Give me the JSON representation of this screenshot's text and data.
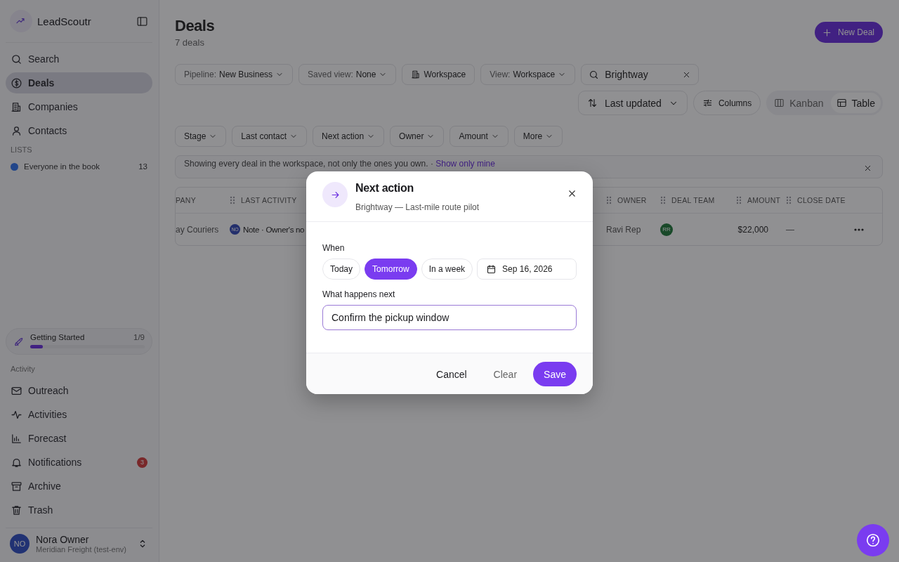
{
  "sidebar": {
    "brand": "LeadScoutr",
    "nav": [
      {
        "label": "Search",
        "selected": false
      },
      {
        "label": "Deals",
        "selected": true
      },
      {
        "label": "Companies",
        "selected": false
      },
      {
        "label": "Contacts",
        "selected": false
      }
    ],
    "lists_heading": "LISTS",
    "lists": [
      {
        "label": "Everyone in the book",
        "count": "13",
        "color": "#22468a"
      }
    ],
    "getting_started": {
      "label": "Getting Started",
      "progress_text": "1/9",
      "level": 0.11
    },
    "activity_heading": "Activity",
    "activity_nav": [
      {
        "label": "Outreach",
        "selected": false
      },
      {
        "label": "Activities",
        "selected": false
      },
      {
        "label": "Forecast",
        "selected": false
      },
      {
        "label": "Notifications",
        "selected": false,
        "badge": "3"
      },
      {
        "label": "Archive",
        "selected": false
      },
      {
        "label": "Trash",
        "selected": false
      }
    ],
    "user": {
      "initials": "NO",
      "name": "Nora Owner",
      "org": "Meridian Freight (test-env)"
    }
  },
  "header": {
    "title": "Deals",
    "subtitle": "7 deals",
    "new_button": "New Deal"
  },
  "toolbar": [
    {
      "kind": "select",
      "label": "Pipeline:",
      "value": "New Business"
    },
    {
      "kind": "select",
      "label": "Saved view:",
      "value": "None"
    },
    {
      "kind": "button",
      "value": "Workspace"
    },
    {
      "kind": "select",
      "label": "View:",
      "value": "Workspace"
    }
  ],
  "search": {
    "value": "Brightway"
  },
  "sort": {
    "label": "Last updated"
  },
  "columns_button": "Columns",
  "view_toggle": [
    {
      "label": "Kanban",
      "selected": false
    },
    {
      "label": "Table",
      "selected": true
    }
  ],
  "filters": [
    "Stage",
    "Last contact",
    "Next action",
    "Owner",
    "Amount",
    "More"
  ],
  "notice": {
    "text": "Showing every deal in the workspace, not only the ones you own.",
    "separator": "·",
    "link": "Show only mine"
  },
  "table": {
    "columns": [
      "PANY",
      "LAST ACTIVITY",
      "OWNER",
      "DEAL TEAM",
      "AMOUNT",
      "CLOSE DATE"
    ],
    "rows": [
      {
        "company": "ay Couriers",
        "activity_initials": "NO",
        "activity": "Note · Owner's no",
        "owner": "Ravi Rep",
        "team": "RR",
        "amount": "$22,000",
        "close": "—"
      }
    ]
  },
  "dialog": {
    "title": "Next action",
    "subtitle": "Brightway — Last-mile route pilot",
    "when_label": "When",
    "when_options": [
      {
        "label": "Today",
        "selected": false
      },
      {
        "label": "Tomorrow",
        "selected": true
      },
      {
        "label": "In a week",
        "selected": false
      }
    ],
    "date": "Sep 16, 2026",
    "next_label": "What happens next",
    "next_value": "Confirm the pickup window",
    "buttons": [
      {
        "kind": "plain",
        "label": "Cancel"
      },
      {
        "kind": "muted",
        "label": "Clear"
      },
      {
        "kind": "primary",
        "label": "Save"
      }
    ]
  }
}
